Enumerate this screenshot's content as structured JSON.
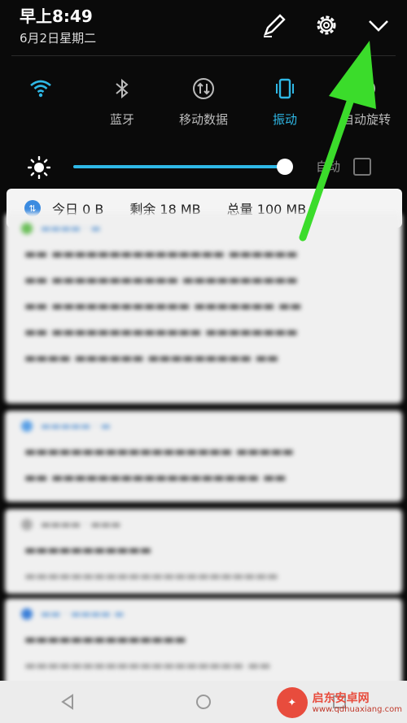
{
  "status": {
    "time": "早上8:49",
    "date": "6月2日星期二"
  },
  "top_actions": [
    {
      "name": "edit-icon"
    },
    {
      "name": "settings-gear-icon"
    },
    {
      "name": "collapse-chevron-icon"
    }
  ],
  "quick_settings": [
    {
      "label": "",
      "icon": "wifi-icon",
      "active": true
    },
    {
      "label": "蓝牙",
      "icon": "bluetooth-icon",
      "active": false
    },
    {
      "label": "移动数据",
      "icon": "mobile-data-icon",
      "active": false
    },
    {
      "label": "振动",
      "icon": "vibrate-icon",
      "active": true
    },
    {
      "label": "自动旋转",
      "icon": "auto-rotate-icon",
      "active": false
    }
  ],
  "brightness": {
    "level": 0.96,
    "auto_label": "自动",
    "auto_checked": false
  },
  "data_usage": {
    "today": "今日 0 B",
    "remaining": "剩余 18 MB",
    "total": "总量 100 MB"
  },
  "watermark": {
    "name": "启东安卓网",
    "url": "www.qdhuaxiang.com"
  },
  "colors": {
    "accent": "#2fb8e6",
    "annotation_arrow": "#3bdc2b"
  }
}
